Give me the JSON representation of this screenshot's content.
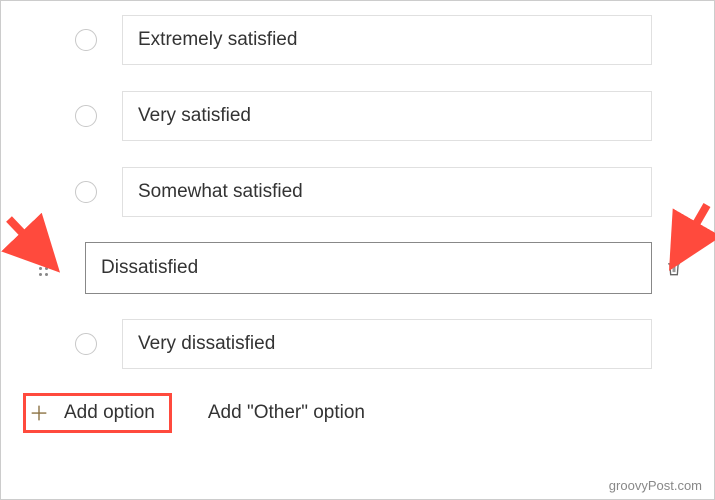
{
  "options": [
    {
      "label": "Extremely satisfied",
      "selected": false
    },
    {
      "label": "Very satisfied",
      "selected": false
    },
    {
      "label": "Somewhat satisfied",
      "selected": false
    },
    {
      "label": "Dissatisfied",
      "selected": true
    },
    {
      "label": "Very dissatisfied",
      "selected": false
    }
  ],
  "actions": {
    "add_option": "Add option",
    "add_other": "Add \"Other\" option"
  },
  "watermark": "groovyPost.com",
  "annotations": {
    "highlight_add_option": true,
    "arrow_left_target": "drag-handle",
    "arrow_right_target": "delete-icon"
  },
  "colors": {
    "arrow": "#ff4a3d",
    "highlight": "#ff4a3d"
  }
}
